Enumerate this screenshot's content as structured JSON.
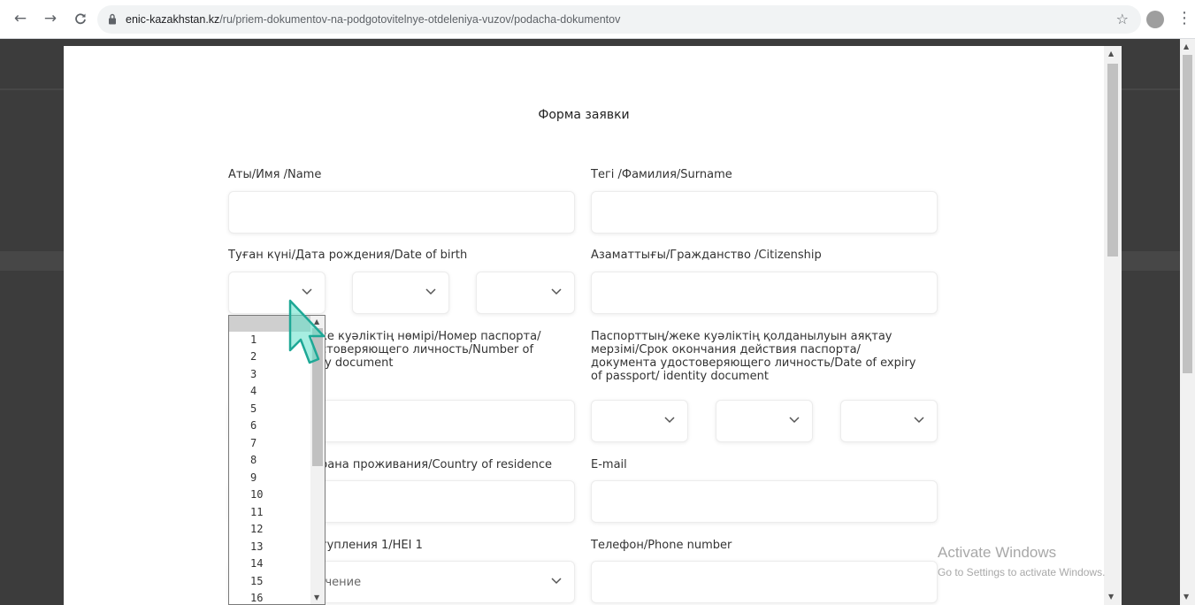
{
  "browser": {
    "url_domain": "enic-kazakhstan.kz",
    "url_path": "/ru/priem-dokumentov-na-podgotovitelnye-otdeleniya-vuzov/podacha-dokumentov"
  },
  "form": {
    "title": "Форма заявки",
    "name_label": "Аты/Имя /Name",
    "surname_label": "Тегі /Фамилия/Surname",
    "birth_label": "Туған күні/Дата рождения/Date of birth",
    "citizenship_label": "Азаматтығы/Гражданство /Citizenship",
    "passport_label_lines": [
      "ке куәліктің нөмірі/Номер паспорта/",
      "стоверяющего личность/Number of",
      "ty document"
    ],
    "expiry_label_lines": [
      "Паспорттың/жеке куәліктің қолданылуын аяқтау",
      "мерзімі/Срок окончания действия паспорта/",
      "документа удостоверяющего личность/Date of expiry",
      "of passport/ identity document"
    ],
    "residence_label": "рана проживания/Country of residence",
    "email_label": "E-mail",
    "hei_label": "тупления 1/HEI 1",
    "phone_label": "Телефон/Phone number",
    "hei_placeholder": "начение"
  },
  "dropdown": {
    "options": [
      "1",
      "2",
      "3",
      "4",
      "5",
      "6",
      "7",
      "8",
      "9",
      "10",
      "11",
      "12",
      "13",
      "14",
      "15",
      "16"
    ]
  },
  "watermark": {
    "line1": "Activate Windows",
    "line2": "Go to Settings to activate Windows."
  }
}
